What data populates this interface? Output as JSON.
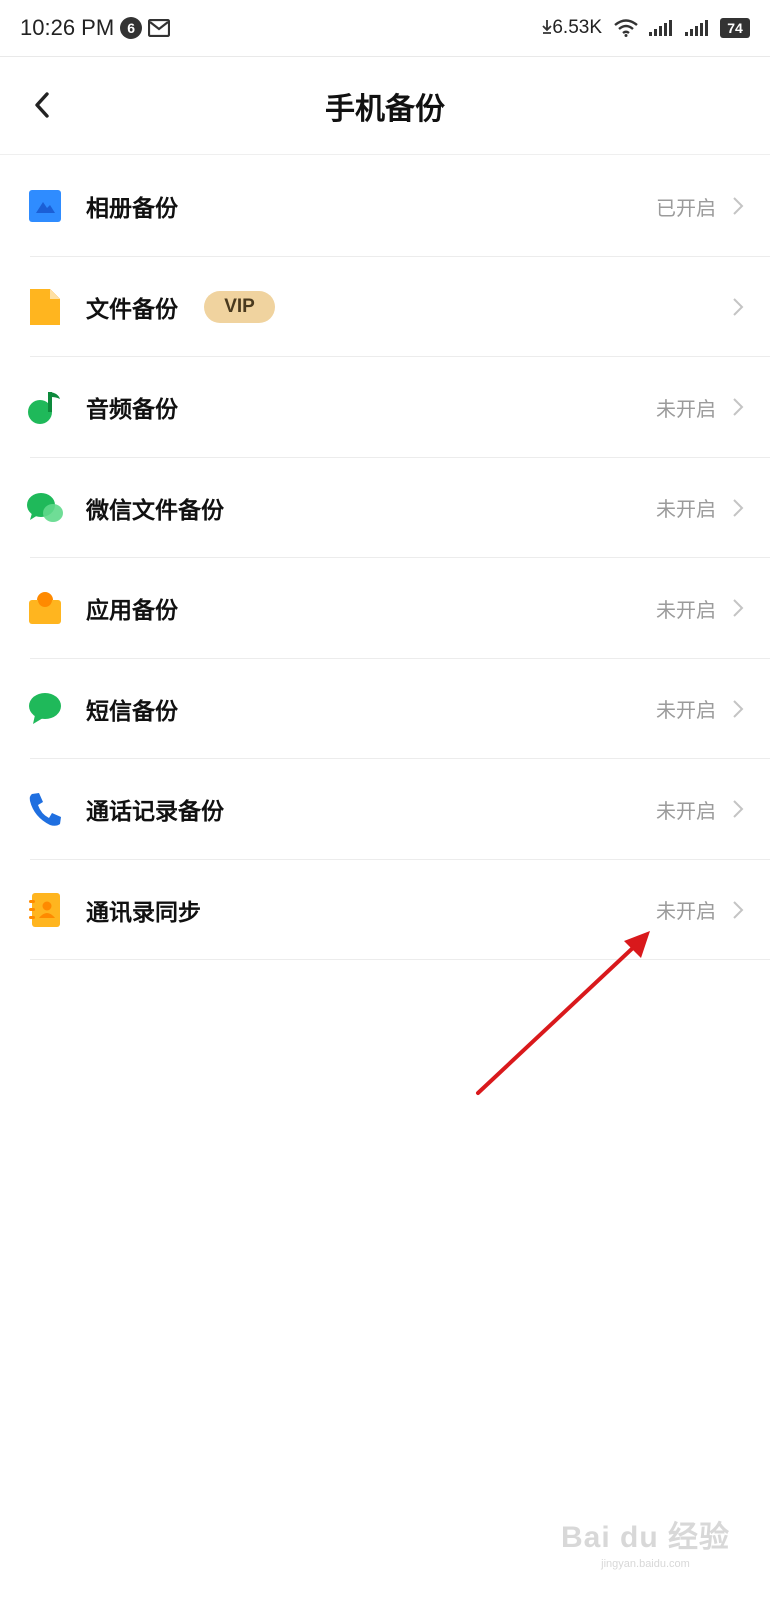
{
  "status_bar": {
    "time": "10:26 PM",
    "notification_count": "6",
    "net_speed": "6.53K",
    "battery": "74"
  },
  "nav": {
    "title": "手机备份"
  },
  "items": [
    {
      "label": "相册备份",
      "status": "已开启",
      "icon": "album-icon",
      "color": "#2f8cff"
    },
    {
      "label": "文件备份",
      "badge": "VIP",
      "status": "",
      "icon": "file-icon",
      "color": "#ffb51f"
    },
    {
      "label": "音频备份",
      "status": "未开启",
      "icon": "music-note-icon",
      "color": "#1fb95a"
    },
    {
      "label": "微信文件备份",
      "status": "未开启",
      "icon": "wechat-icon",
      "color": "#1fb95a"
    },
    {
      "label": "应用备份",
      "status": "未开启",
      "icon": "app-bag-icon",
      "color": "#ffb51f"
    },
    {
      "label": "短信备份",
      "status": "未开启",
      "icon": "sms-bubble-icon",
      "color": "#1fb95a"
    },
    {
      "label": "通话记录备份",
      "status": "未开启",
      "icon": "phone-icon",
      "color": "#1f6fe0"
    },
    {
      "label": "通讯录同步",
      "status": "未开启",
      "icon": "contacts-book-icon",
      "color": "#ffb51f"
    }
  ],
  "colors": {
    "annotation_arrow": "#d9191c",
    "status_text": "#9b9b9b",
    "vip_badge_bg": "#f0d39f"
  },
  "watermark": {
    "brand": "Bai du 经验",
    "url": "jingyan.baidu.com"
  }
}
